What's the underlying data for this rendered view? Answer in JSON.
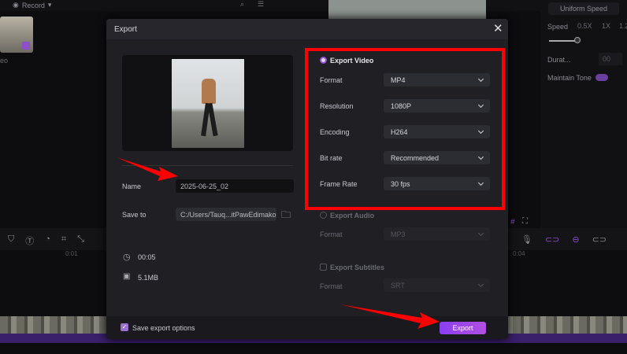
{
  "editor": {
    "record_label": "Record",
    "media_label": "eo",
    "speed_mode": "Uniform Speed",
    "speed_label": "Speed",
    "speed_marks": [
      "0.5X",
      "1X",
      "1.2"
    ],
    "duration_label": "Durat...",
    "duration_value": "00",
    "maintain_tone_label": "Maintain Tone",
    "ruler_ticks": [
      "0:01",
      "0:04"
    ]
  },
  "dialog": {
    "title": "Export",
    "name_label": "Name",
    "name_value": "2025-06-25_02",
    "save_to_label": "Save to",
    "save_to_value": "C:/Users/Tauq...itPawEdimakor",
    "duration": "00:05",
    "size": "5.1MB",
    "export_video_label": "Export Video",
    "video_rows": [
      {
        "label": "Format",
        "value": "MP4"
      },
      {
        "label": "Resolution",
        "value": "1080P"
      },
      {
        "label": "Encoding",
        "value": "H264"
      },
      {
        "label": "Bit rate",
        "value": "Recommended"
      },
      {
        "label": "Frame Rate",
        "value": "30  fps"
      }
    ],
    "export_audio_label": "Export Audio",
    "audio_format_label": "Format",
    "audio_format_value": "MP3",
    "export_subtitles_label": "Export Subtitles",
    "subtitle_format_label": "Format",
    "subtitle_format_value": "SRT",
    "save_options_label": "Save export options",
    "export_button": "Export"
  },
  "colors": {
    "accent": "#9b4fe0",
    "annotation": "#ff0000"
  }
}
